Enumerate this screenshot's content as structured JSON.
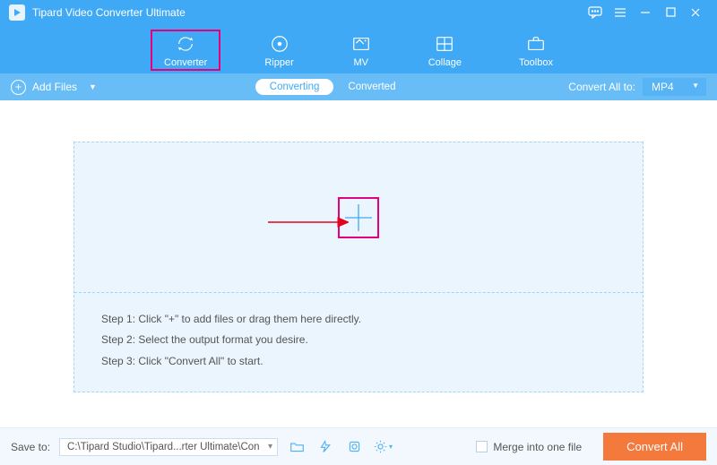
{
  "title": "Tipard Video Converter Ultimate",
  "nav": {
    "converter": "Converter",
    "ripper": "Ripper",
    "mv": "MV",
    "collage": "Collage",
    "toolbox": "Toolbox"
  },
  "subbar": {
    "add_files": "Add Files",
    "tab_converting": "Converting",
    "tab_converted": "Converted",
    "convert_all_to": "Convert All to:",
    "format": "MP4"
  },
  "steps": {
    "s1": "Step 1: Click \"+\" to add files or drag them here directly.",
    "s2": "Step 2: Select the output format you desire.",
    "s3": "Step 3: Click \"Convert All\" to start."
  },
  "footer": {
    "save_to": "Save to:",
    "path": "C:\\Tipard Studio\\Tipard...rter Ultimate\\Converted",
    "merge": "Merge into one file",
    "convert_all": "Convert All"
  }
}
